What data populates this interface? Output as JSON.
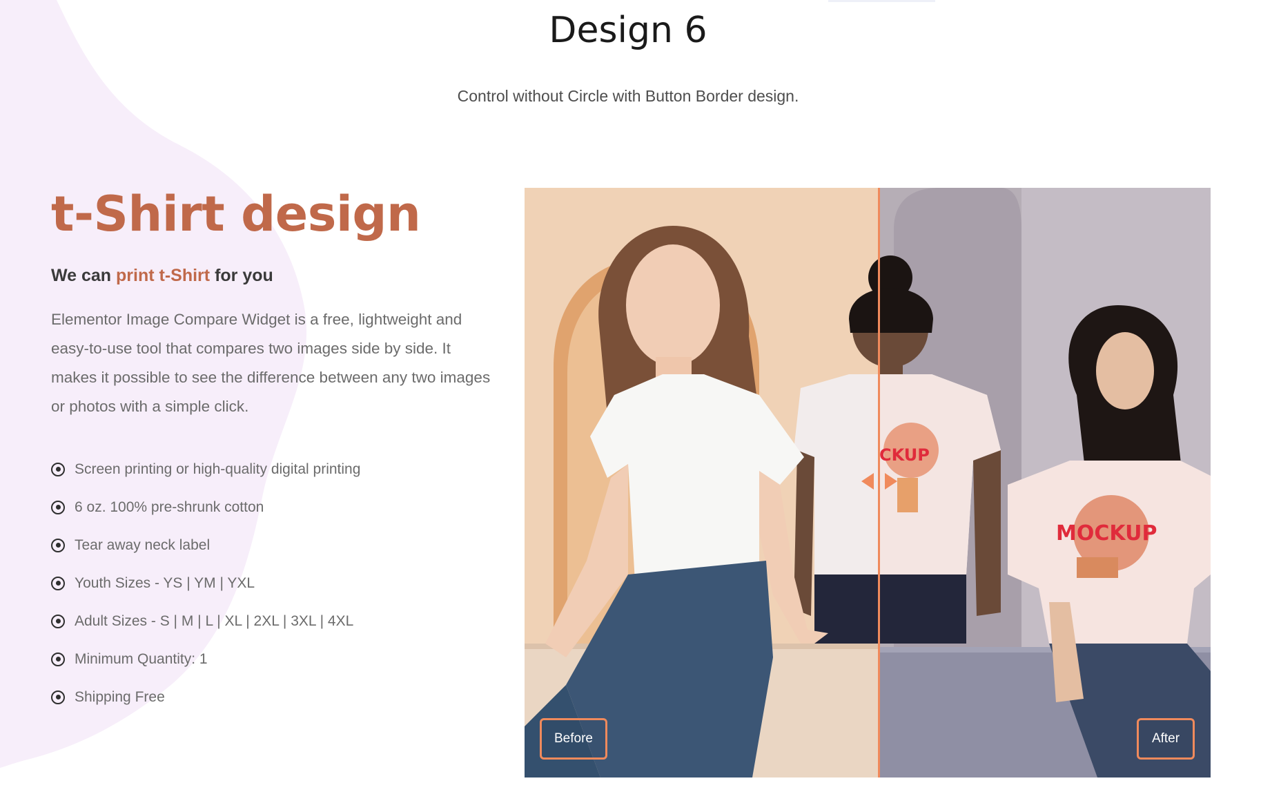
{
  "section": {
    "title": "Design 6",
    "subtitle": "Control without Circle with Button Border design."
  },
  "product": {
    "title": "t-Shirt design",
    "tagline_prefix": "We can ",
    "tagline_accent": "print t-Shirt",
    "tagline_suffix": " for you",
    "description": "Elementor Image Compare Widget is a free, lightweight and easy-to-use tool that compares two images side by side. It makes it possible to see the difference between any two images or photos with a simple click.",
    "features": [
      "Screen printing or high-quality digital printing",
      "6 oz. 100% pre-shrunk cotton",
      "Tear away neck label",
      "Youth Sizes - YS | YM | YXL",
      "Adult Sizes - S | M | L | XL | 2XL | 3XL | 4XL",
      "Minimum Quantity: 1",
      "Shipping Free"
    ]
  },
  "compare": {
    "before_label": "Before",
    "after_label": "After",
    "mockup_text": "MOCKUP",
    "mockup_partial": "CKUP"
  },
  "colors": {
    "accent": "#c0694a",
    "divider": "#f08a5c",
    "heading": "#1a1a1a",
    "body_text": "#6b6b6b",
    "blob": "#f7eefa"
  },
  "icons": {
    "feature_bullet": "radio-circle-icon",
    "divider_handle": "arrows-left-right-icon"
  }
}
